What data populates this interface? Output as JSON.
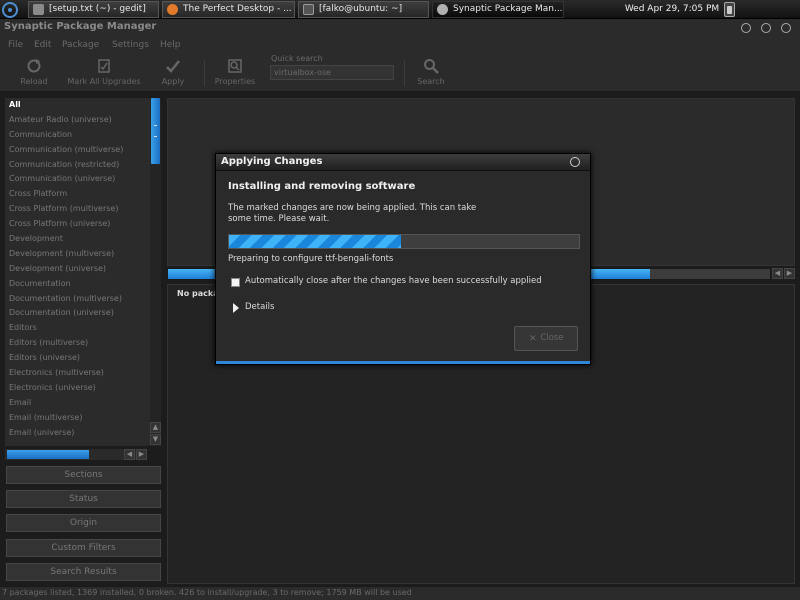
{
  "panel": {
    "tasks": [
      {
        "label": "[setup.txt (~) - gedit]",
        "color": "#8a8a8a"
      },
      {
        "label": "The Perfect Desktop - ...",
        "color": "#e27a2b"
      },
      {
        "label": "[falko@ubuntu: ~]",
        "color": "#555555"
      },
      {
        "label": "Synaptic Package Man...",
        "color": "#b0b0b0"
      }
    ],
    "clock": "Wed Apr 29,  7:05 PM"
  },
  "window": {
    "title": "Synaptic Package Manager",
    "menu": [
      "File",
      "Edit",
      "Package",
      "Settings",
      "Help"
    ],
    "toolbar": {
      "reload": "Reload",
      "mark_all": "Mark All Upgrades",
      "apply": "Apply",
      "properties": "Properties",
      "quick_search_label": "Quick search",
      "quick_search_value": "virtualbox-ose",
      "search": "Search"
    }
  },
  "sections": [
    "All",
    "Amateur Radio (universe)",
    "Communication",
    "Communication (multiverse)",
    "Communication (restricted)",
    "Communication (universe)",
    "Cross Platform",
    "Cross Platform (multiverse)",
    "Cross Platform (universe)",
    "Development",
    "Development (multiverse)",
    "Development (universe)",
    "Documentation",
    "Documentation (multiverse)",
    "Documentation (universe)",
    "Editors",
    "Editors (multiverse)",
    "Editors (universe)",
    "Electronics (multiverse)",
    "Electronics (universe)",
    "Email",
    "Email (multiverse)",
    "Email (universe)"
  ],
  "filters": [
    "Sections",
    "Status",
    "Origin",
    "Custom Filters",
    "Search Results"
  ],
  "package_area": {
    "description_prefix": "No packa"
  },
  "right_progress": 0.8,
  "status_bar": "7 packages listed, 1369 installed, 0 broken. 426 to install/upgrade, 3 to remove; 1759 MB will be used",
  "dialog": {
    "title": "Applying Changes",
    "heading": "Installing and removing software",
    "description": "The marked changes are now being applied. This can take some time. Please wait.",
    "progress": 0.49,
    "status": "Preparing to configure ttf-bengali-fonts",
    "auto_close_label": "Automatically close after the changes have been successfully applied",
    "details_label": "Details",
    "close_label": "Close"
  },
  "colors": {
    "accent": "#2f86d6",
    "background": "#1c1c1c"
  }
}
